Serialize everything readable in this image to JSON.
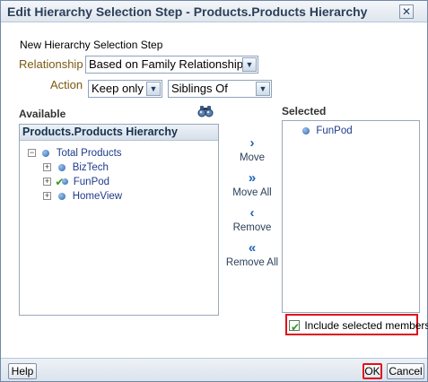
{
  "dialog": {
    "title": "Edit Hierarchy Selection Step - Products.Products Hierarchy",
    "close_glyph": "✕"
  },
  "form": {
    "heading": "New Hierarchy Selection Step",
    "relationship_label": "Relationship",
    "relationship_value": "Based on Family Relationship",
    "action_label": "Action",
    "action_value": "Keep only",
    "family_value": "Siblings Of"
  },
  "available": {
    "label": "Available",
    "panel_title": "Products.Products Hierarchy",
    "tree": [
      {
        "label": "Total Products",
        "expander": "−",
        "checked": false
      },
      {
        "label": "BizTech",
        "expander": "+",
        "checked": false
      },
      {
        "label": "FunPod",
        "expander": "+",
        "checked": true
      },
      {
        "label": "HomeView",
        "expander": "+",
        "checked": false
      }
    ]
  },
  "actions": {
    "move": "Move",
    "move_all": "Move All",
    "remove": "Remove",
    "remove_all": "Remove All"
  },
  "selected": {
    "label": "Selected",
    "items": [
      "FunPod"
    ]
  },
  "include_selected": {
    "label": "Include selected members",
    "checked": true
  },
  "footer": {
    "help": "Help",
    "ok": "OK",
    "cancel": "Cancel"
  },
  "colors": {
    "highlight_border": "#e0101d",
    "accent_blue": "#2163b8",
    "label_olive": "#7a5a10"
  },
  "icons": [
    "search-binoculars-icon",
    "close-icon",
    "move-icon",
    "move-all-icon",
    "remove-icon",
    "remove-all-icon"
  ]
}
